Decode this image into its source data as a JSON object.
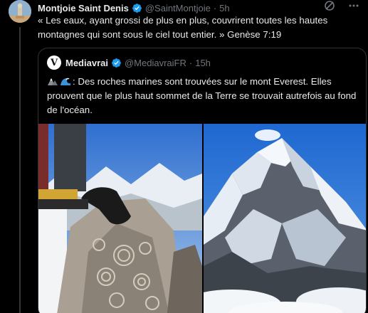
{
  "author": {
    "name": "Montjoie Saint Denis",
    "handle": "@SaintMontjoie",
    "separator": "·",
    "time": "5h",
    "verified": true,
    "verified_color": "#1d9bf0",
    "avatar_icon": "statue-avatar"
  },
  "tweet": {
    "text": "« Les eaux, ayant grossi de plus en plus, couvrirent toutes les hautes montagnes qui sont sous le ciel tout entier. » Genèse 7:19"
  },
  "actions": {
    "icons": [
      "grok-icon",
      "more-icon"
    ]
  },
  "quote": {
    "name": "Mediavrai",
    "handle": "@MediavraiFR",
    "separator": "·",
    "time": "15h",
    "verified": true,
    "avatar_letter": "V",
    "emoji_icons": [
      "mountain-emoji",
      "wave-emoji"
    ],
    "text": ": Des roches marines sont trouvées sur le mont Everest. Elles prouvent que le plus haut sommet de la Terre se trouvait autrefois au fond de l'océan.",
    "media": [
      {
        "name": "fossil-rocks-photo"
      },
      {
        "name": "snowy-mountain-peak-photo"
      }
    ]
  },
  "colors": {
    "background": "#000000",
    "text": "#e7e9ea",
    "muted": "#71767b",
    "border": "#2f3336",
    "accent": "#1d9bf0"
  }
}
